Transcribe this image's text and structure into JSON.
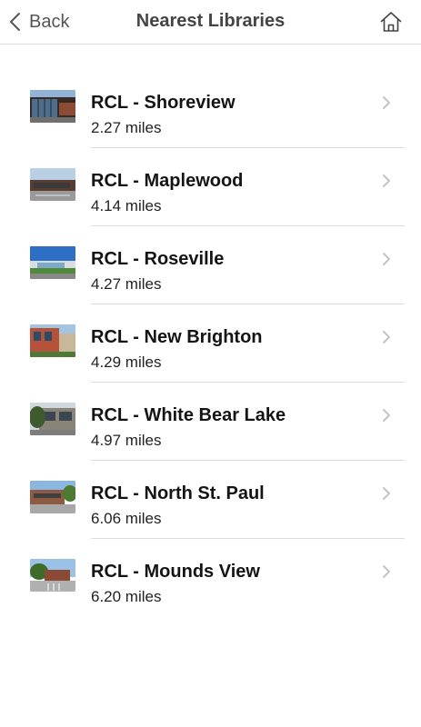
{
  "navbar": {
    "back_label": "Back",
    "title": "Nearest Libraries",
    "back_icon": "chevron-left-icon",
    "home_icon": "home-icon"
  },
  "libraries": [
    {
      "name": "RCL - Shoreview",
      "distance": "2.27 miles",
      "thumbnail": "library-photo-shoreview"
    },
    {
      "name": "RCL - Maplewood",
      "distance": "4.14 miles",
      "thumbnail": "library-photo-maplewood"
    },
    {
      "name": "RCL - Roseville",
      "distance": "4.27 miles",
      "thumbnail": "library-photo-roseville"
    },
    {
      "name": "RCL - New Brighton",
      "distance": "4.29 miles",
      "thumbnail": "library-photo-new-brighton"
    },
    {
      "name": "RCL - White Bear Lake",
      "distance": "4.97 miles",
      "thumbnail": "library-photo-white-bear-lake"
    },
    {
      "name": "RCL - North St. Paul",
      "distance": "6.06 miles",
      "thumbnail": "library-photo-north-st-paul"
    },
    {
      "name": "RCL - Mounds View",
      "distance": "6.20 miles",
      "thumbnail": "library-photo-mounds-view"
    }
  ],
  "colors": {
    "background": "#ffffff",
    "title": "#444444",
    "separator": "#dddddd",
    "chevron": "#c4c4c4"
  }
}
